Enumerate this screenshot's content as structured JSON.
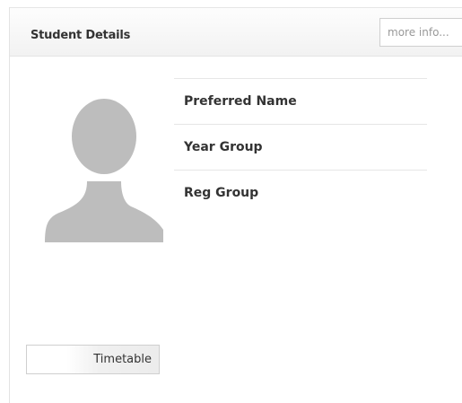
{
  "panel": {
    "title": "Student Details",
    "more_info_label": "more info..."
  },
  "avatar": {
    "icon": "person-silhouette-icon",
    "color": "#bdbdbd"
  },
  "details": {
    "rows": [
      {
        "label": "Preferred Name",
        "value": ""
      },
      {
        "label": "Year Group",
        "value": ""
      },
      {
        "label": "Reg Group",
        "value": ""
      }
    ]
  },
  "actions": {
    "timetable_label": "Timetable"
  },
  "colors": {
    "header_bg": "#f4f4f4",
    "text": "#333333",
    "muted_text": "#999999",
    "border": "#e6e6e6"
  }
}
